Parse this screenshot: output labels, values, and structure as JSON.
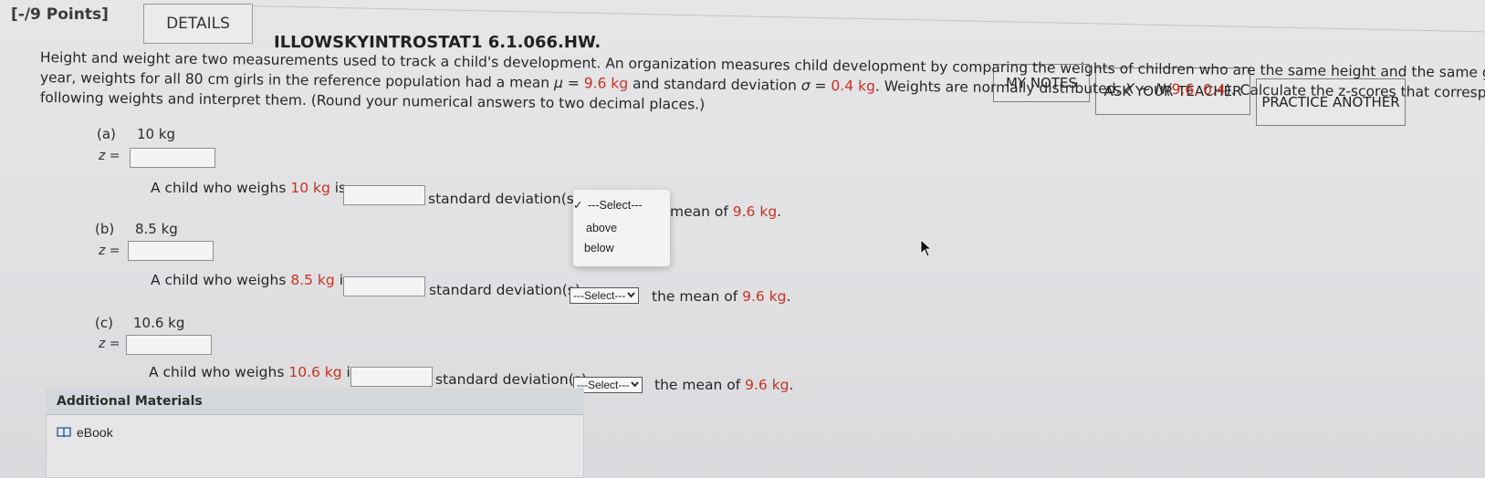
{
  "header": {
    "points": "[-/9 Points]",
    "details_label": "DETAILS",
    "assignment_id": "ILLOWSKYINTROSTAT1 6.1.066.HW."
  },
  "actions": {
    "my_notes": "MY NOTES",
    "ask_teacher": "ASK YOUR TEACHER",
    "practice_another": "PRACTICE ANOTHER"
  },
  "problem": {
    "line1": "Height and weight are two measurements used to track a child's development. An organization measures child development by comparing the weights of children who are the same height and the same gender. In a certain",
    "line2a": "year, weights for all 80 cm girls in the reference population had a mean ",
    "mu": "μ = ",
    "mu_val": "9.6 kg",
    "line2b": " and standard deviation ",
    "sigma": "σ = ",
    "sigma_val": "0.4 kg",
    "line2c": ". Weights are normally distributed. ",
    "dist_x": "X ~ N(",
    "dist_val": "9.6, 0.4",
    "dist_close": ").",
    "line2d": " Calculate the z-scores that correspond to the",
    "line3": "following weights and interpret them. (Round your numerical answers to two decimal places.)"
  },
  "parts": [
    {
      "label": "(a)",
      "weight": "10 kg",
      "z": "z =",
      "s1": "A child who weighs ",
      "w": "10 kg",
      "s2": " is",
      "s3": "standard deviation(s",
      "s4": " mean of ",
      "mean": "9.6 kg",
      "s5": "."
    },
    {
      "label": "(b)",
      "weight": "8.5 kg",
      "z": "z =",
      "s1": "A child who weighs ",
      "w": "8.5 kg",
      "s2": " is",
      "s3": "standard deviation(s)",
      "select": "---Select---",
      "s4": " the mean of ",
      "mean": "9.6 kg",
      "s5": "."
    },
    {
      "label": "(c)",
      "weight": "10.6 kg",
      "z": "z =",
      "s1": "A child who weighs ",
      "w": "10.6 kg",
      "s2": " is",
      "s3": "standard deviation(s)",
      "select": "---Select---",
      "s4": " the mean of ",
      "mean": "9.6 kg",
      "s5": "."
    }
  ],
  "dropdown": {
    "check": "✓",
    "selected": "---Select---",
    "options": [
      "above",
      "below"
    ]
  },
  "additional": {
    "title": "Additional Materials",
    "ebook": "eBook"
  }
}
